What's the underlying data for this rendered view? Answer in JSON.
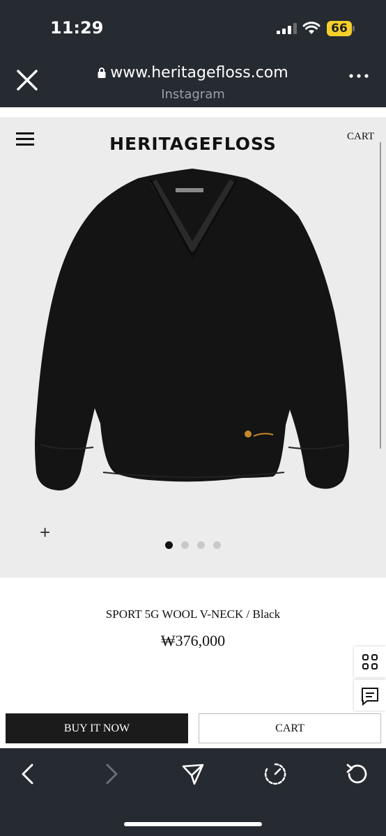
{
  "status": {
    "time": "11:29",
    "battery": "66"
  },
  "browser": {
    "url": "www.heritagefloss.com",
    "source": "Instagram",
    "icons": [
      "close-icon",
      "lock-icon",
      "more-icon"
    ]
  },
  "site": {
    "brand": "HERITAGEFLOSS",
    "cart_link": "CART",
    "menu_icon": "hamburger-icon"
  },
  "product": {
    "title": "SPORT 5G WOOL V-NECK / Black",
    "price": "₩376,000",
    "image": "black-vneck-sweater",
    "carousel": {
      "count": 4,
      "active": 0
    },
    "zoom_icon": "plus-icon"
  },
  "actions": {
    "buy_label": "BUY IT NOW",
    "cart_label": "CART"
  },
  "side_buttons": [
    "grid-icon",
    "chat-icon"
  ],
  "toolbar": [
    "back-icon",
    "forward-icon",
    "share-icon",
    "speed-icon",
    "reload-icon"
  ]
}
